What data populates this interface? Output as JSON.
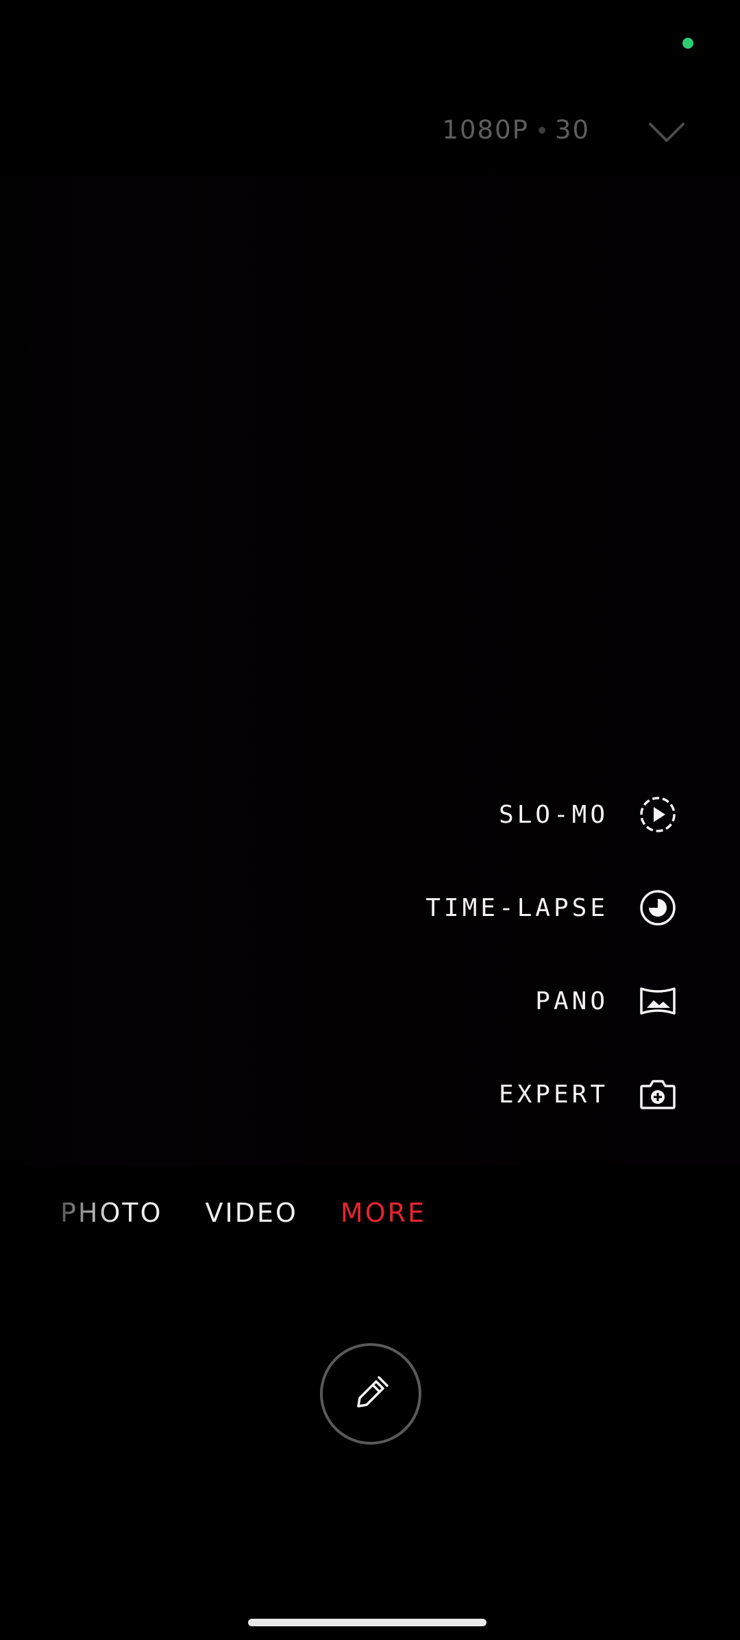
{
  "status": {
    "mic_indicator_color": "#2ecc71"
  },
  "header": {
    "resolution": "1080P",
    "frame_rate": "30",
    "expand_icon": "chevron-down-icon"
  },
  "more_menu": {
    "items": [
      {
        "label": "SLO-MO",
        "icon": "slo-mo-icon"
      },
      {
        "label": "TIME-LAPSE",
        "icon": "time-lapse-icon"
      },
      {
        "label": "PANO",
        "icon": "pano-icon"
      },
      {
        "label": "EXPERT",
        "icon": "expert-camera-icon"
      }
    ]
  },
  "mode_tabs": [
    {
      "label": "PHOTO",
      "selected": false
    },
    {
      "label": "VIDEO",
      "selected": false
    },
    {
      "label": "MORE",
      "selected": true
    }
  ],
  "colors": {
    "accent": "#e5252f",
    "tab_text": "#f0f0f0",
    "muted_text": "#5e5e5e"
  },
  "shutter": {
    "icon": "pencil-icon"
  }
}
